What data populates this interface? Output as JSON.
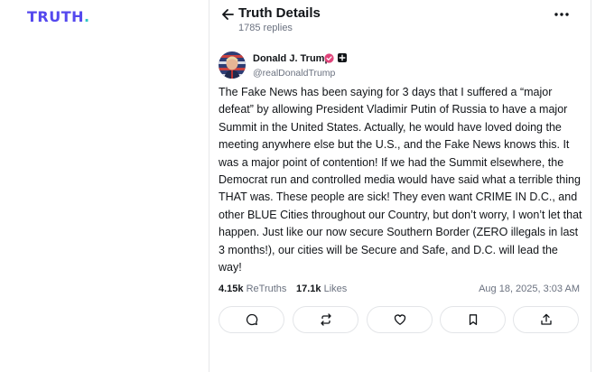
{
  "brand": {
    "logo_text": "TRUTH",
    "logo_dot": ".",
    "accent": "#5448ee",
    "dot_color": "#2ec4c4"
  },
  "header": {
    "title": "Truth Details",
    "replies": "1785 replies"
  },
  "post": {
    "author_name": "Donald J. Trump",
    "handle": "@realDonaldTrump",
    "verified_color": "#e0457b",
    "text": "The Fake News has been saying for 3 days that I suffered a “major defeat” by allowing President Vladimir Putin of Russia to have a major Summit in the United States. Actually, he would have loved doing the meeting anywhere else but the U.S., and the Fake News knows this. It was a major point of contention! If we had the Summit elsewhere, the Democrat run and controlled media would have said what a terrible thing THAT was. These people are sick! They even want CRIME IN D.C., and other BLUE Cities throughout our Country, but don’t worry, I won’t let that happen. Just like our now secure Southern Border (ZERO illegals in last 3 months!), our cities will be Secure and Safe, and D.C. will lead the way!",
    "retruths_count": "4.15k",
    "retruths_label": "ReTruths",
    "likes_count": "17.1k",
    "likes_label": "Likes",
    "timestamp": "Aug 18, 2025, 3:03 AM"
  },
  "actions": [
    "reply-icon",
    "retruth-icon",
    "like-icon",
    "bookmark-icon",
    "share-icon"
  ]
}
